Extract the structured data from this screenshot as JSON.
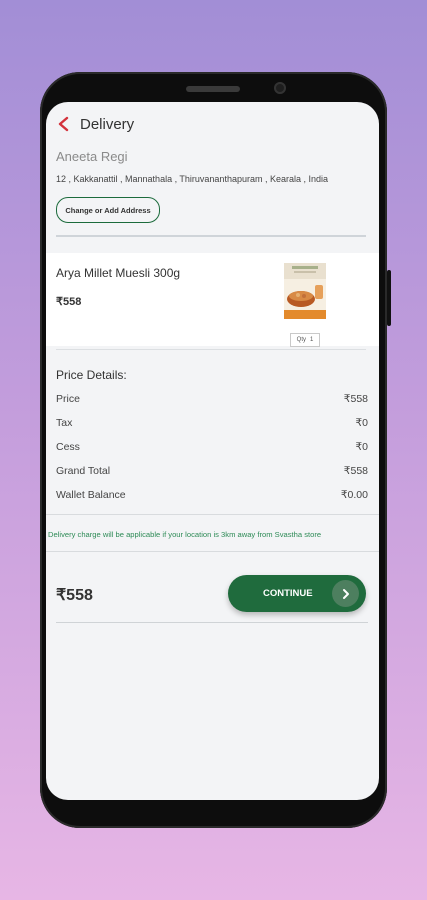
{
  "header": {
    "title": "Delivery"
  },
  "address": {
    "name": "Aneeta Regi",
    "line": "12 , Kakkanattil , Mannathala , Thiruvananthapuram , Kearala , India",
    "change_button": "Change or Add Address"
  },
  "product": {
    "name": "Arya Millet Muesli 300g",
    "price": "₹558",
    "qty_label": "Qty",
    "qty_value": "1"
  },
  "price_details": {
    "title": "Price Details:",
    "rows": [
      {
        "label": "Price",
        "value": "₹558"
      },
      {
        "label": "Tax",
        "value": "₹0"
      },
      {
        "label": "Cess",
        "value": "₹0"
      },
      {
        "label": "Grand Total",
        "value": "₹558"
      },
      {
        "label": "Wallet Balance",
        "value": "₹0.00"
      }
    ]
  },
  "notice": "Delivery charge will be applicable if your location is 3km away from Svastha store",
  "footer": {
    "total": "₹558",
    "continue_label": "CONTINUE"
  },
  "colors": {
    "accent": "#1f6b3d",
    "back_arrow": "#d3323c",
    "notice": "#2e8b57"
  }
}
